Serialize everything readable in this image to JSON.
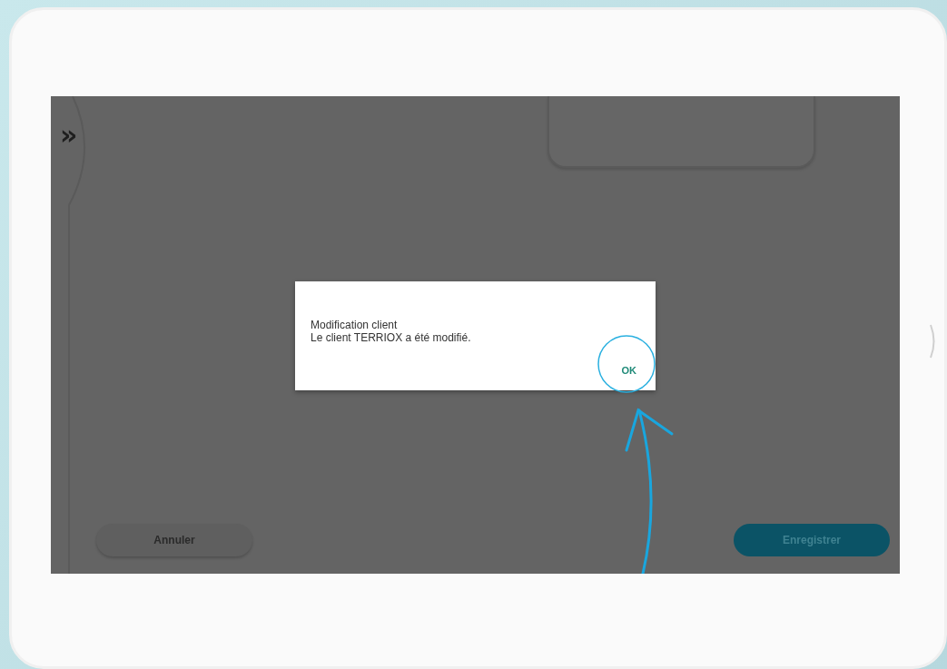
{
  "sidebar_toggle": {
    "glyph": "»"
  },
  "dialog": {
    "title": "Modification client",
    "message": "Le client TERRIOX a été modifié.",
    "button": "OK"
  },
  "buttons": [
    {
      "kind": "secondary",
      "label": "Annuler"
    },
    {
      "kind": "primary",
      "label": "Enregistrer"
    }
  ]
}
